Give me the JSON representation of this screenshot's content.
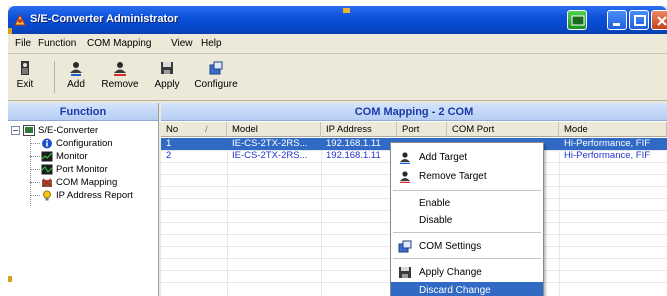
{
  "window": {
    "title": "S/E-Converter Administrator"
  },
  "menu": {
    "items": [
      "File",
      "Function",
      "COM Mapping",
      "View",
      "Help"
    ]
  },
  "toolbar": {
    "exit": "Exit",
    "add": "Add",
    "remove": "Remove",
    "apply": "Apply",
    "configure": "Configure"
  },
  "function_panel": {
    "header": "Function",
    "root": "S/E-Converter",
    "items": [
      "Configuration",
      "Monitor",
      "Port Monitor",
      "COM Mapping",
      "IP Address Report"
    ],
    "selected": "COM Mapping"
  },
  "main": {
    "header": "COM Mapping - 2 COM",
    "columns": [
      "No",
      "Model",
      "IP Address",
      "Port",
      "COM Port",
      "Mode"
    ],
    "sort_indicator": "/",
    "rows": [
      {
        "no": "1",
        "model": "IE-CS-2TX-2RS...",
        "ip": "192.168.1.11",
        "port": "",
        "com": "",
        "mode": "Hi-Performance, FIF",
        "selected": true
      },
      {
        "no": "2",
        "model": "IE-CS-2TX-2RS...",
        "ip": "192.168.1.11",
        "port": "",
        "com": "",
        "mode": "Hi-Performance, FIF",
        "selected": false
      }
    ]
  },
  "context_menu": {
    "add_target": "Add Target",
    "remove_target": "Remove Target",
    "enable": "Enable",
    "disable": "Disable",
    "com_settings": "COM Settings",
    "apply_change": "Apply Change",
    "discard_change": "Discard Change",
    "highlighted": "Discard Change"
  },
  "colors": {
    "titlebar": "#0a4ed8",
    "selection": "#316ac5",
    "panel_header_text": "#1b3aa8",
    "row_text": "#2233cc"
  }
}
